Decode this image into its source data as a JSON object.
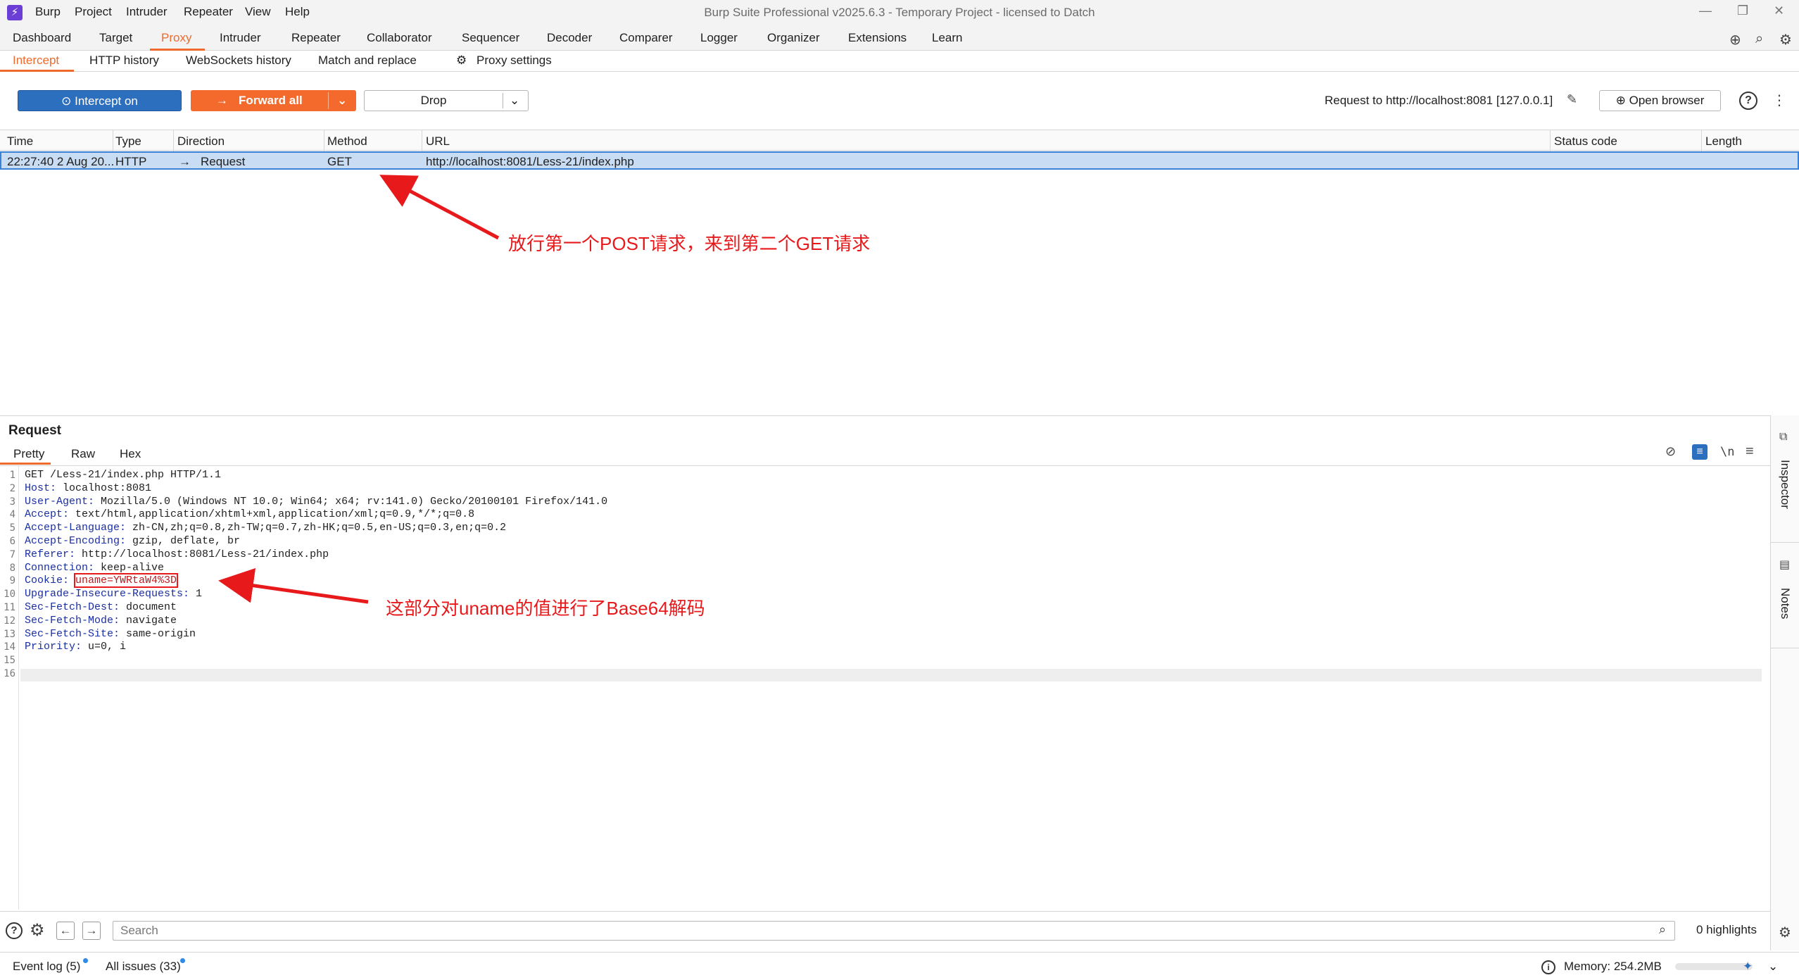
{
  "window": {
    "title": "Burp Suite Professional v2025.6.3 - Temporary Project - licensed to Datch",
    "menu": [
      "Burp",
      "Project",
      "Intruder",
      "Repeater",
      "View",
      "Help"
    ]
  },
  "main_tabs": [
    "Dashboard",
    "Target",
    "Proxy",
    "Intruder",
    "Repeater",
    "Collaborator",
    "Sequencer",
    "Decoder",
    "Comparer",
    "Logger",
    "Organizer",
    "Extensions",
    "Learn"
  ],
  "active_main_tab": "Proxy",
  "sub_tabs": [
    "Intercept",
    "HTTP history",
    "WebSockets history",
    "Match and replace",
    "Proxy settings"
  ],
  "active_sub_tab": "Intercept",
  "toolbar": {
    "intercept_label": "Intercept on",
    "forward_label": "Forward all",
    "drop_label": "Drop",
    "request_to": "Request to http://localhost:8081  [127.0.0.1]",
    "open_browser_label": "Open browser"
  },
  "table": {
    "columns": [
      "Time",
      "Type",
      "Direction",
      "Method",
      "URL",
      "Status code",
      "Length"
    ],
    "rows": [
      {
        "time": "22:27:40 2 Aug 20...",
        "type": "HTTP",
        "direction": "Request",
        "method": "GET",
        "url": "http://localhost:8081/Less-21/index.php",
        "status": "",
        "length": ""
      }
    ]
  },
  "annotations": {
    "top": "放行第一个POST请求，来到第二个GET请求",
    "bottom": "这部分对uname的值进行了Base64解码"
  },
  "request": {
    "title": "Request",
    "tabs": [
      "Pretty",
      "Raw",
      "Hex"
    ],
    "active_tab": "Pretty",
    "lines": [
      {
        "n": "1",
        "key": "",
        "value": "GET /Less-21/index.php HTTP/1.1"
      },
      {
        "n": "2",
        "key": "Host:",
        "value": " localhost:8081"
      },
      {
        "n": "3",
        "key": "User-Agent:",
        "value": " Mozilla/5.0 (Windows NT 10.0; Win64; x64; rv:141.0) Gecko/20100101 Firefox/141.0"
      },
      {
        "n": "4",
        "key": "Accept:",
        "value": " text/html,application/xhtml+xml,application/xml;q=0.9,*/*;q=0.8"
      },
      {
        "n": "5",
        "key": "Accept-Language:",
        "value": " zh-CN,zh;q=0.8,zh-TW;q=0.7,zh-HK;q=0.5,en-US;q=0.3,en;q=0.2"
      },
      {
        "n": "6",
        "key": "Accept-Encoding:",
        "value": " gzip, deflate, br"
      },
      {
        "n": "7",
        "key": "Referer:",
        "value": " http://localhost:8081/Less-21/index.php"
      },
      {
        "n": "8",
        "key": "Connection:",
        "value": " keep-alive"
      },
      {
        "n": "9",
        "key": "Cookie:",
        "value": " ",
        "boxed": "uname=YWRtaW4%3D"
      },
      {
        "n": "10",
        "key": "Upgrade-Insecure-Requests:",
        "value": " 1"
      },
      {
        "n": "11",
        "key": "Sec-Fetch-Dest:",
        "value": " document"
      },
      {
        "n": "12",
        "key": "Sec-Fetch-Mode:",
        "value": " navigate"
      },
      {
        "n": "13",
        "key": "Sec-Fetch-Site:",
        "value": " same-origin"
      },
      {
        "n": "14",
        "key": "Priority:",
        "value": " u=0, i"
      },
      {
        "n": "15",
        "key": "",
        "value": ""
      },
      {
        "n": "16",
        "key": "",
        "value": ""
      }
    ]
  },
  "sidebar": [
    "Inspector",
    "Notes"
  ],
  "search": {
    "placeholder": "Search",
    "highlights": "0 highlights"
  },
  "status_bar": {
    "event_log": "Event log (5)",
    "all_issues": "All issues (33)",
    "memory": "Memory: 254.2MB"
  },
  "colors": {
    "accent": "#ef6a2d",
    "intercept_blue": "#2d6fbf",
    "annotation_red": "#e8191b",
    "selected_row": "#c8dcf3"
  }
}
